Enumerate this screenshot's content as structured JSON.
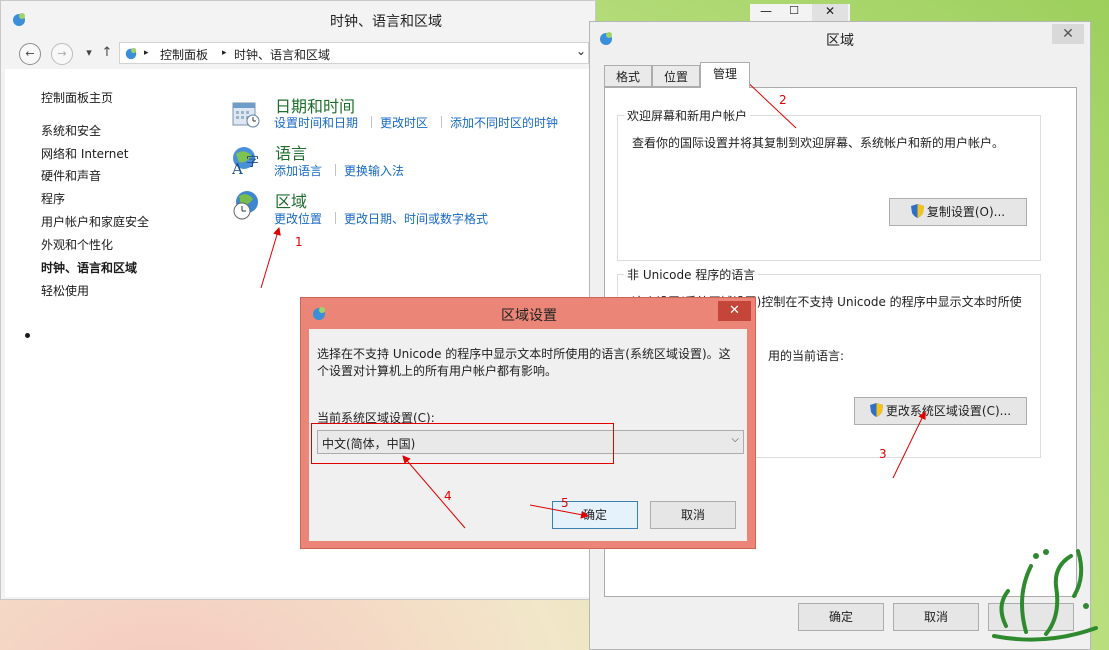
{
  "control_panel": {
    "title": "时钟、语言和区域",
    "nav": {
      "back": "←",
      "forward": "→",
      "recent": "▾",
      "up": "↑"
    },
    "address": {
      "sep1": "▸",
      "seg1": "控制面板",
      "sep2": "▸",
      "seg2": "时钟、语言和区域",
      "dropdown": "⌄"
    },
    "sidebar": {
      "home": "控制面板主页",
      "items": [
        "系统和安全",
        "网络和 Internet",
        "硬件和声音",
        "程序",
        "用户帐户和家庭安全",
        "外观和个性化",
        "时钟、语言和区域",
        "轻松使用"
      ]
    },
    "categories": {
      "datetime": {
        "title": "日期和时间",
        "links": [
          "设置时间和日期",
          "更改时区",
          "添加不同时区的时钟"
        ]
      },
      "language": {
        "title": "语言",
        "links": [
          "添加语言",
          "更换输入法"
        ]
      },
      "region": {
        "title": "区域",
        "links": [
          "更改位置",
          "更改日期、时间或数字格式"
        ]
      }
    }
  },
  "region_window": {
    "title": "区域",
    "close": "✕",
    "tabs": [
      "格式",
      "位置",
      "管理"
    ],
    "welcome_group": {
      "legend": "欢迎屏幕和新用户帐户",
      "text": "查看你的国际设置并将其复制到欢迎屏幕、系统帐户和新的用户帐户。",
      "button": "复制设置(O)..."
    },
    "unicode_group": {
      "legend": "非 Unicode 程序的语言",
      "text_line1": "这个设置(系统区域设置)控制在不支持 Unicode 的程序中显示文本时所使",
      "text_line2": "用的当前语言:",
      "button": "更改系统区域设置(C)..."
    },
    "ok": "确定",
    "cancel": "取消"
  },
  "region_settings_dialog": {
    "title": "区域设置",
    "close": "✕",
    "description_line1": "选择在不支持 Unicode 的程序中显示文本时所使用的语言(系统区域设置)。这",
    "description_line2": "个设置对计算机上的所有用户帐户都有影响。",
    "select_label": "当前系统区域设置(C):",
    "select_value": "中文(简体，中国)",
    "select_arrow": "⌵",
    "ok": "确定",
    "cancel": "取消"
  },
  "annotations": [
    "1",
    "2",
    "3",
    "4",
    "5"
  ],
  "colors": {
    "link": "#1769c6",
    "category": "#1e6e2c",
    "annotation": "#e00000",
    "dialog_frame": "#ea8578"
  }
}
